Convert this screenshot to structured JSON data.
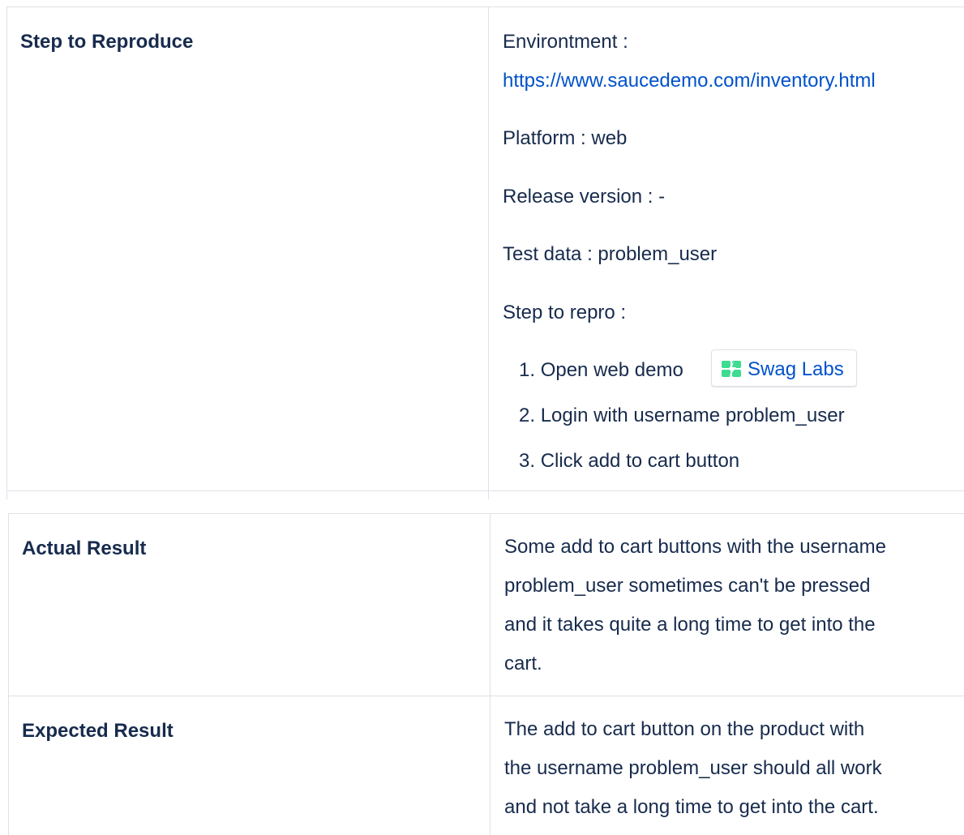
{
  "step_table": {
    "label": "Step to Reproduce",
    "environment_label": "Environtment :",
    "environment_url": "https://www.saucedemo.com/inventory.html",
    "platform": "Platform : web",
    "release_version": "Release version : -",
    "test_data": "Test data : problem_user",
    "steps_heading": "Step to repro :",
    "steps": [
      {
        "number": "1.",
        "text": "Open web demo"
      },
      {
        "number": "2.",
        "text": "Login with username problem_user"
      },
      {
        "number": "3.",
        "text": "Click add to cart button"
      }
    ],
    "smart_link": {
      "icon": "swag-labs-logo-icon",
      "label": "Swag Labs",
      "icon_color": "#3ddc91"
    }
  },
  "result_table": {
    "actual_label": "Actual Result",
    "actual_lines": [
      "Some add to cart buttons with the username",
      "problem_user sometimes can't be pressed",
      "and it takes quite a long time to get into the",
      "cart."
    ],
    "expected_label": "Expected Result",
    "expected_lines": [
      "The add to cart button on the product with",
      "the username problem_user should all work",
      "and not take a long time to get into the cart."
    ]
  },
  "colors": {
    "text": "#172b4d",
    "link": "#0052cc",
    "border": "#dfe1e6"
  }
}
